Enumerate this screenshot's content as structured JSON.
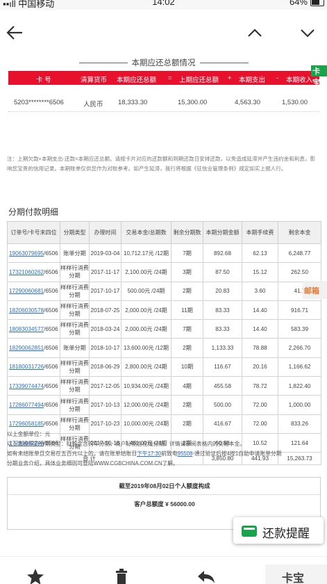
{
  "status_bar": {
    "carrier": "▪▪ıll 中国移动",
    "time": "14:02",
    "battery": "64%"
  },
  "summary": {
    "title": "本期应还总额情况",
    "headers": {
      "card": "卡 号",
      "currency": "清算货币",
      "due": "本期应还总额",
      "eq": "=",
      "last_due": "上期应还总额",
      "plus": "+",
      "spend": "本期支出",
      "minus": "-",
      "income": "本期收入"
    },
    "row": {
      "card": "5203********6506",
      "currency": "人民币",
      "due": "18,333.30",
      "last_due": "15,300.00",
      "spend": "4,563.30",
      "income": "1,530.00"
    },
    "note": "注：上期欠款+本期支出-还款=本期应还总额。请按卡片对应的还款额和到期还款日安排还款，以免造成延滞并产生违约金和利息，影响您宝贵的信用记录。本期账单仅供您作为对账参考。如产生延滞，我行将根据《征信业管理条例》规定如实上报人行。"
  },
  "installments": {
    "title": "分期付款明细",
    "headers": [
      "订单号/卡号末四位",
      "分期类型",
      "办理时间",
      "交易本金/总期数",
      "剩余分期数",
      "本期分期金额",
      "本期手续费",
      "剩余本金"
    ],
    "rows": [
      {
        "order": "19063079695",
        "card": "/6506",
        "type": "账单分期",
        "date": "2019-03-04",
        "amount": "10,712.17元 /12期",
        "remain": "7期",
        "cur": "892.68",
        "fee": "62.13",
        "principal": "6,248.77"
      },
      {
        "order": "17321060262",
        "card": "/6506",
        "type": "样样行消费分期",
        "date": "2017-11-17",
        "amount": "2,100.00元 /24期",
        "remain": "3期",
        "cur": "87.50",
        "fee": "15.12",
        "principal": "262.50"
      },
      {
        "order": "17290060681",
        "card": "/6506",
        "type": "样样行消费分期",
        "date": "2017-10-17",
        "amount": "500.00元 /24期",
        "remain": "2期",
        "cur": "20.83",
        "fee": "3.60",
        "principal": "41.7"
      },
      {
        "order": "18206030578",
        "card": "/6506",
        "type": "样样行消费分期",
        "date": "2018-07-25",
        "amount": "2,000.00元 /24期",
        "remain": "11期",
        "cur": "83.33",
        "fee": "14.40",
        "principal": "916.71"
      },
      {
        "order": "18083034577",
        "card": "/6506",
        "type": "样样行消费分期",
        "date": "2018-03-24",
        "amount": "2,000.00元 /24期",
        "remain": "7期",
        "cur": "83.33",
        "fee": "14.40",
        "principal": "583.39"
      },
      {
        "order": "18290062851",
        "card": "/6506",
        "type": "账单分期",
        "date": "2018-10-17",
        "amount": "13,600.00元 /12期",
        "remain": "2期",
        "cur": "1,133.33",
        "fee": "78.88",
        "principal": "2,266.70"
      },
      {
        "order": "18180031726",
        "card": "/6506",
        "type": "样样行消费分期",
        "date": "2018-06-29",
        "amount": "2,800.00元 /24期",
        "remain": "10期",
        "cur": "116.67",
        "fee": "20.16",
        "principal": "1,166.62"
      },
      {
        "order": "17339074474",
        "card": "/6506",
        "type": "样样行消费分期",
        "date": "2017-12-05",
        "amount": "10,934.00元 /24期",
        "remain": "4期",
        "cur": "455.58",
        "fee": "78.72",
        "principal": "1,822.40"
      },
      {
        "order": "17286077494",
        "card": "/6506",
        "type": "样样行消费分期",
        "date": "2017-10-13",
        "amount": "12,000.00元 /24期",
        "remain": "2期",
        "cur": "500.00",
        "fee": "72.00",
        "principal": "1,000.00"
      },
      {
        "order": "17296058185",
        "card": "/6506",
        "type": "样样行消费分期",
        "date": "2017-10-23",
        "amount": "10,000.00元 /24期",
        "remain": "2期",
        "cur": "416.67",
        "fee": "72.00",
        "principal": "833.26"
      },
      {
        "order": "17291062246",
        "card": "/6506",
        "type": "样样行消费分期",
        "date": "2017-10-18",
        "amount": "1,461.00元 /24期",
        "remain": "2期",
        "cur": "60.88",
        "fee": "10.52",
        "principal": "121.64"
      }
    ],
    "total": {
      "label": "合 计",
      "cur": "3,850.80",
      "fee": "441.93",
      "principal": "15,263.73"
    },
    "foot1": "以上金额单位：元",
    "foot2": "以上表格中的分期类型：财智金含购车分期，商户分期含在线分期，详情请参阅表格内的交易本金。",
    "foot3_a": "如有未结账单且交易在五百元以上的，请在账单结账日",
    "foot3_time": "下午17:30",
    "foot3_b": "前致电",
    "foot3_phone": "95508",
    "foot3_c": "-通过验证后按4按1自助申请账单分期",
    "foot4": "分期业务介绍，具体业务细则可登陆WWW.CGBCHINA.COM.CN了解。"
  },
  "limit": {
    "line1": "截至2019年08月02日个人额度构成",
    "line2": "客户总额度 ¥ 56000.00"
  },
  "remind": {
    "label": "还款提醒"
  },
  "watermark": {
    "right": "邮箱",
    "corner": "卡宝",
    "logo": "卡宝"
  }
}
